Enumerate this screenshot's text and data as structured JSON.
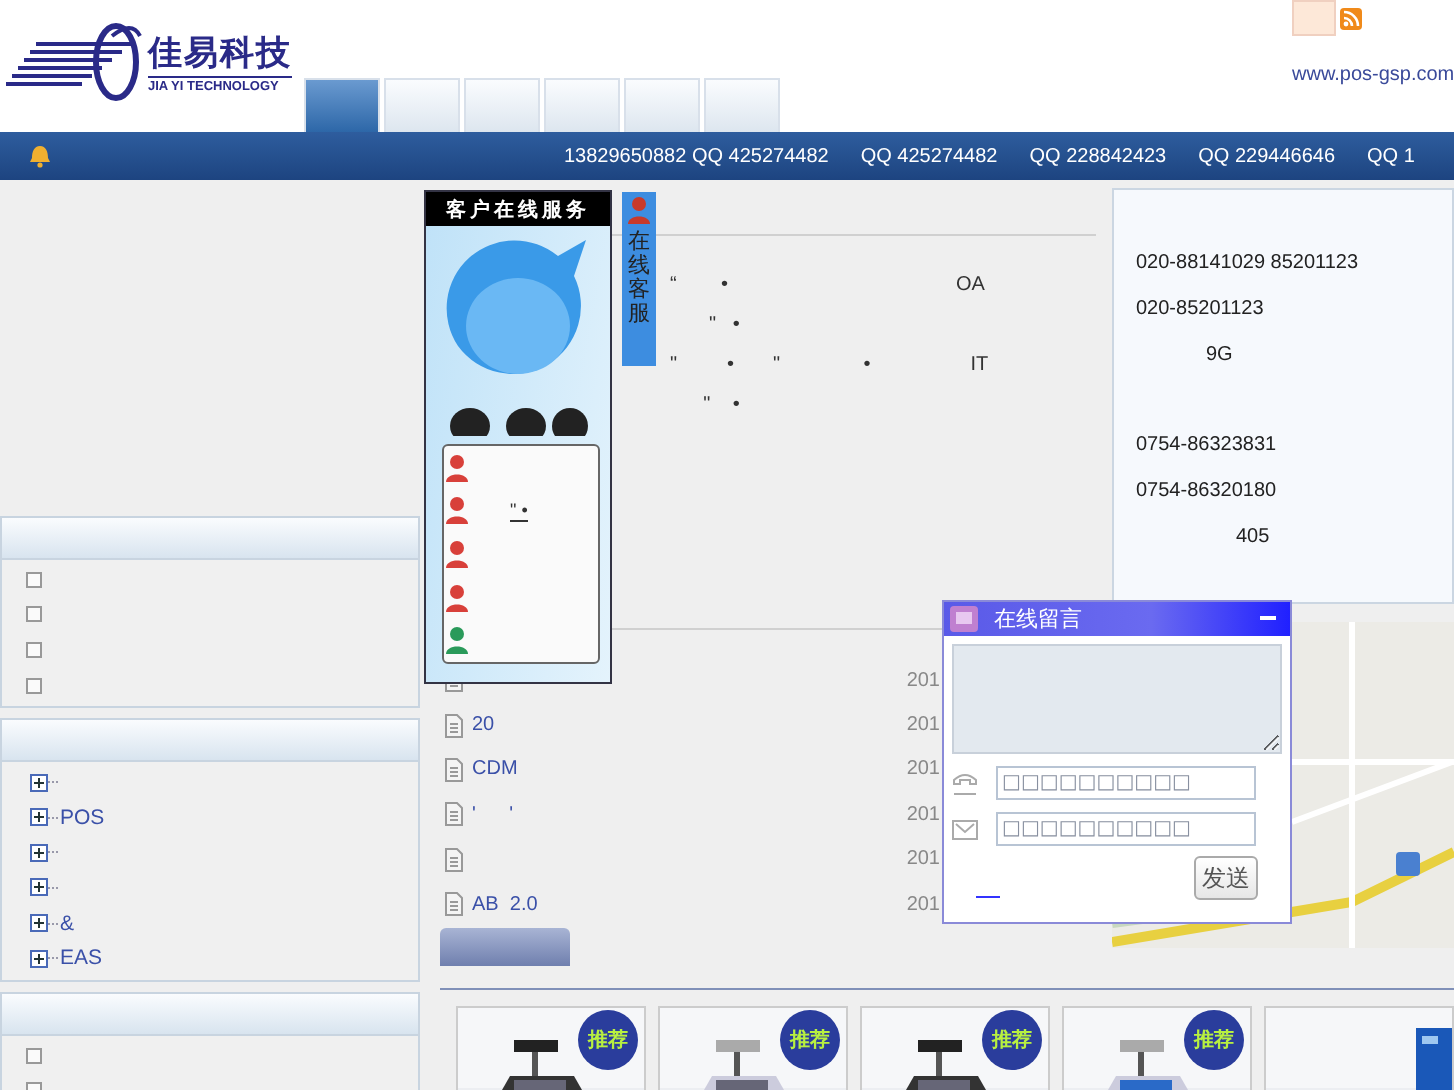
{
  "header": {
    "logo_text": "佳易科技",
    "logo_subtitle": "JIA YI TECHNOLOGY",
    "website": "www.pos-gsp.com"
  },
  "nav_tabs": [
    {
      "selected": true
    },
    {
      "selected": false
    },
    {
      "selected": false
    },
    {
      "selected": false
    },
    {
      "selected": false
    },
    {
      "selected": false
    }
  ],
  "ticker": [
    "13829650882 QQ 425274482",
    "QQ 425274482",
    "QQ 228842423",
    "QQ 229446646",
    "QQ 1"
  ],
  "sidebar": {
    "panels": [
      {
        "kind": "list",
        "items": [
          {
            "kind": "bullet"
          },
          {
            "kind": "bullet"
          },
          {
            "kind": "bullet"
          },
          {
            "kind": "bullet"
          }
        ]
      },
      {
        "kind": "tree",
        "items": [
          {
            "expanded": false
          },
          {
            "label": "POS",
            "expanded": false
          },
          {
            "expanded": false
          },
          {
            "expanded": false
          },
          {
            "label": "&",
            "expanded": false
          },
          {
            "label": "EAS",
            "expanded": false
          }
        ]
      },
      {
        "kind": "list",
        "items": [
          {
            "kind": "bullet"
          },
          {
            "kind": "bullet"
          }
        ]
      }
    ]
  },
  "intro": [
    "“        •                                         OA",
    "       \"   •",
    "\"         •       \"               •                  IT",
    "      \"    •"
  ],
  "news": [
    {
      "date": "201"
    },
    {
      "title": "20",
      "date": "201"
    },
    {
      "title": "CDM",
      "date": "201"
    },
    {
      "title": "'      '",
      "date": "201"
    },
    {
      "date": "201"
    },
    {
      "title": "AB  2.0",
      "date": "201"
    }
  ],
  "products": [
    {
      "kind": "picture",
      "badge": "推荐"
    },
    {
      "kind": "picture",
      "badge": "推荐"
    },
    {
      "kind": "picture",
      "badge": "推荐"
    },
    {
      "kind": "picture",
      "badge": "推荐"
    },
    {
      "kind": "picture"
    }
  ],
  "contact": {
    "offices": [
      {
        "lines": [
          {
            "kind": "phone",
            "text": "020-88141029 85201123"
          },
          {
            "kind": "phone",
            "text": "020-85201123"
          },
          {
            "kind": "address",
            "text": "9G"
          }
        ]
      },
      {
        "lines": [
          {
            "kind": "phone",
            "text": "0754-86323831"
          },
          {
            "kind": "phone",
            "text": "0754-86320180"
          },
          {
            "kind": "address",
            "text": "405"
          }
        ]
      }
    ]
  },
  "service": {
    "title": "客户在线服务",
    "tab_label": "在线客服",
    "contacts": [
      {
        "kind": "qq"
      },
      {
        "kind": "qq",
        "text": "\" •"
      },
      {
        "kind": "qq"
      },
      {
        "kind": "qq"
      },
      {
        "kind": "msn"
      }
    ]
  },
  "message_box": {
    "title": "在线留言",
    "fields": [
      {
        "kind": "phone",
        "placeholder": "□□□□□□□□□□"
      },
      {
        "kind": "email",
        "placeholder": "□□□□□□□□□□"
      }
    ],
    "send": "发送"
  }
}
